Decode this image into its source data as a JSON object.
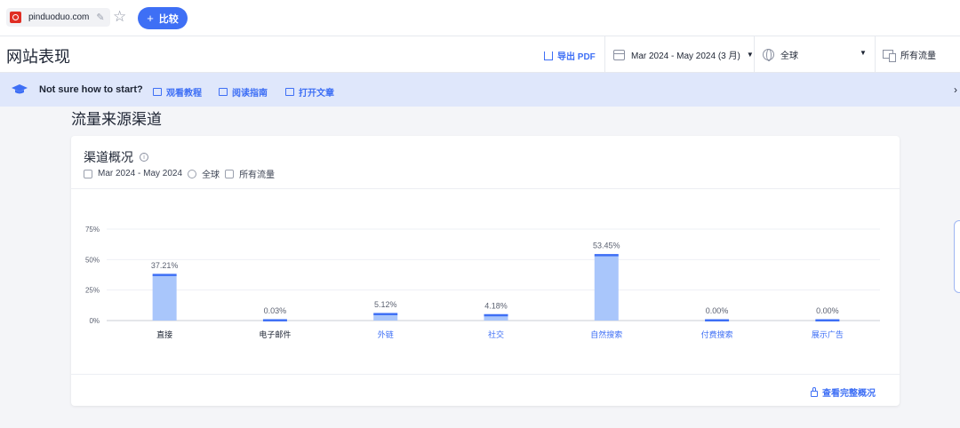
{
  "topbar": {
    "domain": "pinduoduo.com",
    "compare_label": "比较"
  },
  "header": {
    "title": "网站表现",
    "export_label": "导出 PDF",
    "date_range": "Mar 2024 - May 2024 (3 月)",
    "geo": "全球",
    "traffic": "所有流量"
  },
  "banner": {
    "question": "Not sure how to start?",
    "links": [
      "观看教程",
      "阅读指南",
      "打开文章"
    ]
  },
  "section": {
    "title": "流量来源渠道"
  },
  "card": {
    "title": "渠道概况",
    "date": "Mar 2024 - May 2024",
    "geo": "全球",
    "traffic": "所有流量",
    "view_all": "查看完整概况"
  },
  "colors": {
    "accent": "#3e6ff5",
    "bar_fill": "#a9c6fb",
    "bar_top": "#3e6ff5"
  },
  "chart_data": {
    "type": "bar",
    "categories": [
      "直接",
      "电子邮件",
      "外链",
      "社交",
      "自然搜索",
      "付费搜索",
      "展示广告"
    ],
    "values": [
      37.21,
      0.03,
      5.12,
      4.18,
      53.45,
      0.0,
      0.0
    ],
    "labels": [
      "37.21%",
      "0.03%",
      "5.12%",
      "4.18%",
      "53.45%",
      "0.00%",
      "0.00%"
    ],
    "yticks": [
      "0%",
      "25%",
      "50%",
      "75%"
    ],
    "ylim": [
      0,
      75
    ],
    "category_link": [
      false,
      false,
      true,
      true,
      true,
      true,
      true
    ],
    "grid": true
  }
}
